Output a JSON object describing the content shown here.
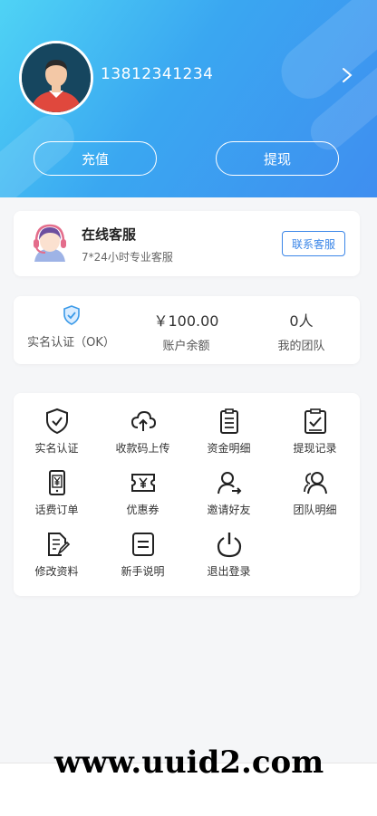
{
  "header": {
    "phone": "13812341234",
    "recharge_label": "充值",
    "withdraw_label": "提现"
  },
  "service": {
    "title": "在线客服",
    "subtitle": "7*24小时专业客服",
    "contact_label": "联系客服"
  },
  "stats": {
    "realname_label": "实名认证（OK）",
    "balance_value": "￥100.00",
    "balance_label": "账户余额",
    "team_value": "0人",
    "team_label": "我的团队"
  },
  "menu": {
    "items": [
      {
        "label": "实名认证",
        "icon": "shield-check-icon"
      },
      {
        "label": "收款码上传",
        "icon": "cloud-upload-icon"
      },
      {
        "label": "资金明细",
        "icon": "clipboard-list-icon"
      },
      {
        "label": "提现记录",
        "icon": "clipboard-check-icon"
      },
      {
        "label": "话费订单",
        "icon": "phone-yen-icon"
      },
      {
        "label": "优惠券",
        "icon": "coupon-icon"
      },
      {
        "label": "邀请好友",
        "icon": "invite-user-icon"
      },
      {
        "label": "团队明细",
        "icon": "team-icon"
      },
      {
        "label": "修改资料",
        "icon": "edit-document-icon"
      },
      {
        "label": "新手说明",
        "icon": "guide-document-icon"
      },
      {
        "label": "退出登录",
        "icon": "power-icon"
      }
    ]
  },
  "watermark": "www.uuid2.com",
  "colors": {
    "header_gradient_start": "#4fd3f5",
    "header_gradient_end": "#3f8ef0",
    "accent_blue": "#3b86e8"
  }
}
